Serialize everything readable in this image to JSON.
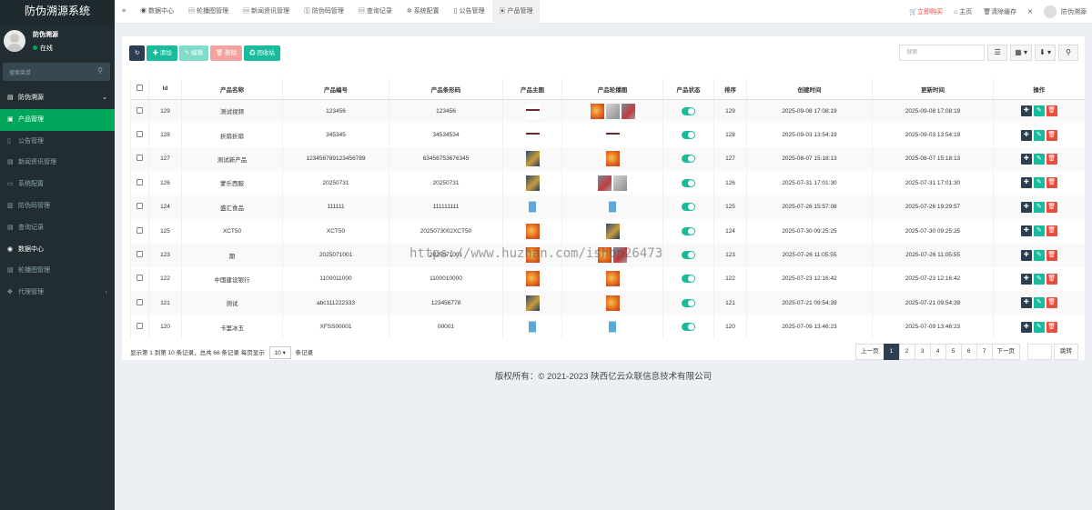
{
  "app": {
    "logo": "防伪溯源系统"
  },
  "user": {
    "name": "防伪溯源",
    "status": "在线"
  },
  "sidebar": {
    "search_placeholder": "搜索菜单",
    "items": [
      {
        "label": "防伪溯源",
        "icon": "▤"
      },
      {
        "label": "产品管理",
        "icon": "▣"
      },
      {
        "label": "公告管理",
        "icon": "▯"
      },
      {
        "label": "新闻资讯管理",
        "icon": "▤"
      },
      {
        "label": "系统配置",
        "icon": "▭"
      },
      {
        "label": "防伪码管理",
        "icon": "▥"
      },
      {
        "label": "查询记录",
        "icon": "▤"
      },
      {
        "label": "数据中心",
        "icon": "◉"
      },
      {
        "label": "轮播图管理",
        "icon": "▤"
      },
      {
        "label": "代理管理",
        "icon": "✥"
      }
    ]
  },
  "topnav": {
    "menu_icon": "≡",
    "tabs": [
      {
        "label": "数据中心",
        "icon": "◉"
      },
      {
        "label": "轮播图管理",
        "icon": "▤"
      },
      {
        "label": "新闻资讯管理",
        "icon": "▤"
      },
      {
        "label": "防伪码管理",
        "icon": "▥"
      },
      {
        "label": "查询记录",
        "icon": "▤"
      },
      {
        "label": "系统配置",
        "icon": "✲"
      },
      {
        "label": "公告管理",
        "icon": "▯"
      },
      {
        "label": "产品管理",
        "icon": "▣"
      }
    ],
    "buy": "立即购买",
    "home": "主页",
    "clear_cache": "清除缓存",
    "expand_icon": "✕",
    "user": "防伪溯源"
  },
  "toolbar": {
    "refresh_icon": "↻",
    "add": "✚ 添加",
    "edit": "✎ 编辑",
    "delete": "🗑 删除",
    "recycle": "♻ 回收站",
    "search_placeholder": "搜索",
    "view_icon": "☰",
    "columns_icon": "▦ ▾",
    "export_icon": "⬇ ▾",
    "search_icon": "⚲"
  },
  "table": {
    "headers": [
      "",
      "Id",
      "产品名称",
      "产品编号",
      "产品条形码",
      "产品主图",
      "产品轮播图",
      "产品状态",
      "排序",
      "创建时间",
      "更新时间",
      "操作"
    ],
    "rows": [
      {
        "id": "129",
        "name": "测试视频",
        "code": "123456",
        "barcode": "123456",
        "main": [
          "bar"
        ],
        "carousel": [
          "fire",
          "gray",
          "red"
        ],
        "sort": "129",
        "created": "2025-09-08 17:08:19",
        "updated": "2025-09-08 17:08:19"
      },
      {
        "id": "128",
        "name": "折扇折扇",
        "code": "345345",
        "barcode": "34534534",
        "main": [
          "bar"
        ],
        "carousel": [
          "bar"
        ],
        "sort": "128",
        "created": "2025-09-03 13:54:19",
        "updated": "2025-09-03 13:54:19"
      },
      {
        "id": "127",
        "name": "测试新产品",
        "code": "123456789123456789",
        "barcode": "63456753676345",
        "main": [
          "book"
        ],
        "carousel": [
          "fire"
        ],
        "sort": "127",
        "created": "2025-08-07 15:18:13",
        "updated": "2025-08-07 15:18:13"
      },
      {
        "id": "126",
        "name": "蒙乐西服",
        "code": "20250731",
        "barcode": "20250731",
        "main": [
          "book"
        ],
        "carousel": [
          "red",
          "gray"
        ],
        "sort": "126",
        "created": "2025-07-31 17:01:30",
        "updated": "2025-07-31 17:01:30"
      },
      {
        "id": "124",
        "name": "盛汇食品",
        "code": "111111",
        "barcode": "111111111",
        "main": [
          "jar"
        ],
        "carousel": [
          "jar"
        ],
        "sort": "125",
        "created": "2025-07-26 15:57:08",
        "updated": "2025-07-26 19:29:57"
      },
      {
        "id": "125",
        "name": "XCT50",
        "code": "XCT50",
        "barcode": "2025073002XCT50",
        "main": [
          "fire"
        ],
        "carousel": [
          "book"
        ],
        "sort": "124",
        "created": "2025-07-30 09:25:25",
        "updated": "2025-07-30 09:25:25"
      },
      {
        "id": "123",
        "name": "期",
        "code": "2025071001",
        "barcode": "2025071001",
        "main": [
          "fire"
        ],
        "carousel": [
          "fire",
          "red"
        ],
        "sort": "123",
        "created": "2025-07-26 11:05:55",
        "updated": "2025-07-26 11:05:55"
      },
      {
        "id": "122",
        "name": "中国建设银行",
        "code": "1100011000",
        "barcode": "1100010000",
        "main": [
          "fire"
        ],
        "carousel": [
          "fire"
        ],
        "sort": "122",
        "created": "2025-07-23 12:16:42",
        "updated": "2025-07-23 12:16:42"
      },
      {
        "id": "121",
        "name": "测试",
        "code": "abc111222333",
        "barcode": "123456778",
        "main": [
          "book"
        ],
        "carousel": [
          "fire"
        ],
        "sort": "121",
        "created": "2025-07-21 09:54:39",
        "updated": "2025-07-21 09:54:39"
      },
      {
        "id": "120",
        "name": "卡里冰玉",
        "code": "XFSS00001",
        "barcode": "00001",
        "main": [
          "jar"
        ],
        "carousel": [
          "jar"
        ],
        "sort": "120",
        "created": "2025-07-09 13:46:23",
        "updated": "2025-07-09 13:46:23"
      }
    ]
  },
  "ops": {
    "plus": "✚",
    "edit": "✎",
    "delete": "🗑"
  },
  "pagination": {
    "info_before": "显示第 1 到第 10 条记录，总共 66 条记录 每页显示",
    "page_size": "10 ▾",
    "info_after": "条记录",
    "prev": "上一页",
    "pages": [
      "1",
      "2",
      "3",
      "4",
      "5",
      "6",
      "7"
    ],
    "current": "1",
    "next": "下一页",
    "jump": "跳转"
  },
  "footer": "版权所有：© 2021-2023 陕西亿云众联信息技术有限公司",
  "watermark": "https://www.huzhan.com/ishop26473",
  "colors": {
    "sidebar": "#222d32",
    "accent": "#18bc9c",
    "dark": "#2c3e50",
    "danger": "#e74c3c",
    "active_menu": "#00a65a"
  }
}
